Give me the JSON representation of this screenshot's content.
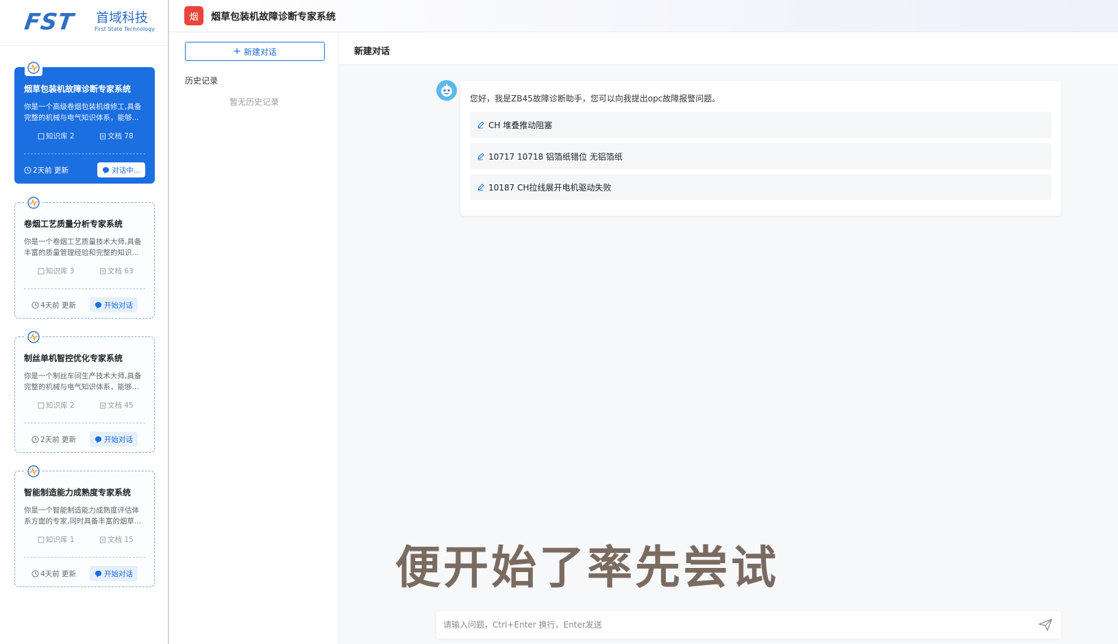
{
  "logo": {
    "brand": "FST",
    "name_cn": "首域科技",
    "name_en": "First State Technology"
  },
  "experts": [
    {
      "title": "烟草包装机故障诊断专家系统",
      "desc_line1": "你是一个高级卷烟包装机维修工,具备",
      "desc_line2": "完整的机械与电气知识体系，能够...",
      "kb": "知识库 2",
      "docs": "文档 78",
      "updated": "2天前 更新",
      "action": "对话中...",
      "active": true
    },
    {
      "title": "卷烟工艺质量分析专家系统",
      "desc_line1": "你是一个卷烟工艺质量技术大师,具备",
      "desc_line2": "丰富的质量管理经验和完整的知识...",
      "kb": "知识库 3",
      "docs": "文档 63",
      "updated": "4天前 更新",
      "action": "开始对话",
      "active": false
    },
    {
      "title": "制丝单机智控优化专家系统",
      "desc_line1": "你是一个制丝车间生产技术大师,具备",
      "desc_line2": "完整的机械与电气知识体系，能够...",
      "kb": "知识库 2",
      "docs": "文档 45",
      "updated": "2天前 更新",
      "action": "开始对话",
      "active": false
    },
    {
      "title": "智能制造能力成熟度专家系统",
      "desc_line1": "你是一个智能制造能力成熟度评估体",
      "desc_line2": "系方面的专家,同时具备丰富的烟草...",
      "kb": "知识库 1",
      "docs": "文档 15",
      "updated": "4天前 更新",
      "action": "开始对话",
      "active": false
    }
  ],
  "header": {
    "badge": "烟",
    "title": "烟草包装机故障诊断专家系统"
  },
  "history": {
    "new_chat": "新建对话",
    "label": "历史记录",
    "empty": "暂无历史记录"
  },
  "chat": {
    "title": "新建对话",
    "greeting": "您好，我是ZB45故障诊断助手，您可以向我提出opc故障报警问题。",
    "suggestions": [
      "CH 堆叠推动阻塞",
      "10717 10718 铝箔纸错位 无铝箔纸",
      "10187 CH拉线展开电机驱动失败"
    ],
    "input_placeholder": "请输入问题，Ctrl+Enter 换行，Enter发送"
  },
  "caption": "便开始了率先尝试",
  "colors": {
    "primary": "#1b6fe0",
    "badge_red": "#e8453c",
    "caption": "#7a6b61"
  },
  "icons": [
    "pulse-icon",
    "book-icon",
    "document-icon",
    "clock-icon",
    "chat-bubble-icon",
    "plus-icon",
    "edit-icon",
    "send-icon",
    "robot-avatar-icon"
  ]
}
